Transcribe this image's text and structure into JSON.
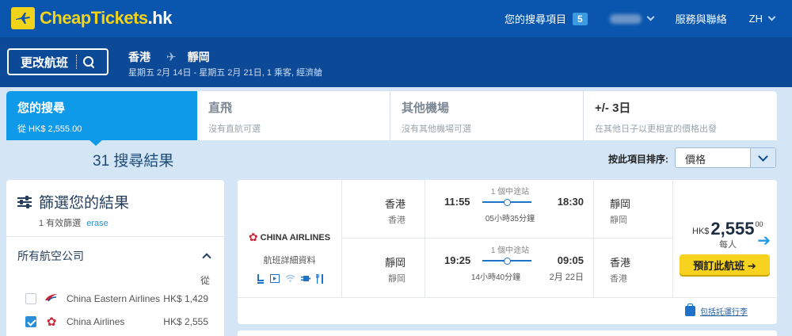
{
  "header": {
    "logo_main": "CheapTickets",
    "logo_suffix": ".hk",
    "searches_label": "您的搜尋項目",
    "searches_count": "5",
    "service_label": "服務與聯絡",
    "language": "ZH"
  },
  "search": {
    "modify_label": "更改航班",
    "origin": "香港",
    "destination": "靜岡",
    "details": "星期五 2月 14日 - 星期五 2月 21日, 1 乘客, 經濟艙"
  },
  "tabs": [
    {
      "title": "您的搜尋",
      "sub": "從 HK$ 2,555.00"
    },
    {
      "title": "直飛",
      "sub": "沒有直航可選"
    },
    {
      "title": "其他機場",
      "sub": "沒有其他機場可選"
    },
    {
      "title": "+/- 3日",
      "sub": "在其他日子以更相宜的價格出發"
    }
  ],
  "results": {
    "count_text": "31 搜尋結果",
    "sort_label": "按此項目排序:",
    "sort_value": "價格"
  },
  "filter": {
    "title": "篩選您的結果",
    "active_text": "1 有效篩選",
    "erase_label": "erase",
    "airlines_heading": "所有航空公司",
    "from_label": "從",
    "airlines": [
      {
        "name": "China Eastern Airlines",
        "price": "HK$ 1,429",
        "checked": false
      },
      {
        "name": "China Airlines",
        "price": "HK$ 2,555",
        "checked": true
      }
    ]
  },
  "card": {
    "airline_name": "CHINA AIRLINES",
    "details_link": "航班詳細資料",
    "amenities": [
      "seat-icon",
      "screen-icon",
      "wifi-icon",
      "power-icon",
      "meal-icon"
    ],
    "outbound": {
      "from_city": "香港",
      "from_airport": "香港",
      "stops": "1 個中途站",
      "dep_time": "11:55",
      "arr_time": "18:30",
      "duration": "05小時35分鐘",
      "to_city": "靜岡",
      "to_airport": "靜岡"
    },
    "inbound": {
      "from_city": "靜岡",
      "from_airport": "靜岡",
      "stops": "1 個中途站",
      "dep_time": "19:25",
      "arr_time": "09:05",
      "duration": "14小時40分鐘",
      "arr_date": "2月 22日",
      "to_city": "香港",
      "to_airport": "香港"
    },
    "price_currency": "HK$",
    "price_amount": "2,555",
    "price_decimals": "00",
    "per_person": "每人",
    "book_label": "預訂此航班 ➔",
    "baggage_label": "包括託運行李"
  },
  "colors": {
    "header_bg": "#0a55ad",
    "strip_bg": "#0c4a98",
    "active_tab": "#0f9ae9",
    "book_button": "#f7d21e",
    "page_bg": "#d4e6f5"
  }
}
